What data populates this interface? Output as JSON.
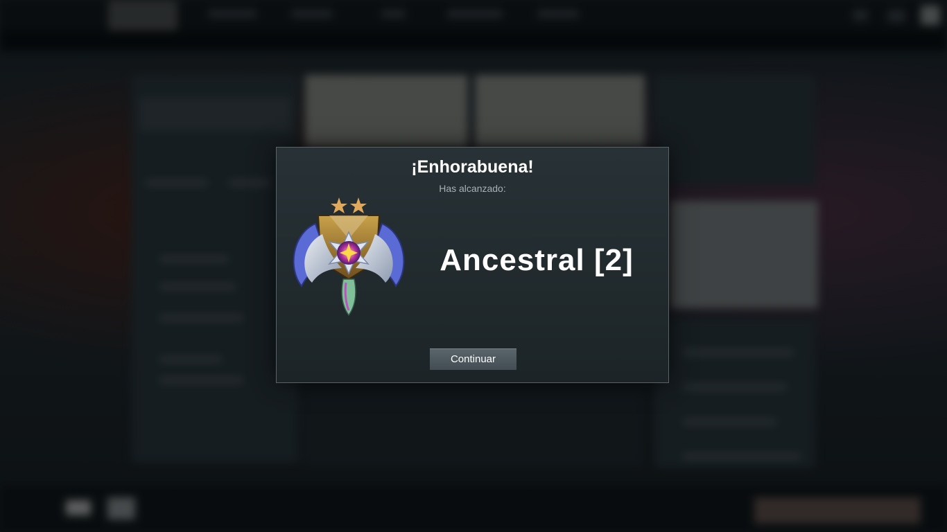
{
  "dialog": {
    "title": "¡Enhorabuena!",
    "subtitle": "Has alcanzado:",
    "rank_name": "Ancestral [2]",
    "rank_stars": 2,
    "medal_icon": "ancestral-medal-icon",
    "continue_label": "Continuar"
  },
  "colors": {
    "dialog_bg": "#232c30",
    "dialog_border": "#5a6368",
    "button_bg": "#4f5a60",
    "star": "#e0a85a"
  }
}
